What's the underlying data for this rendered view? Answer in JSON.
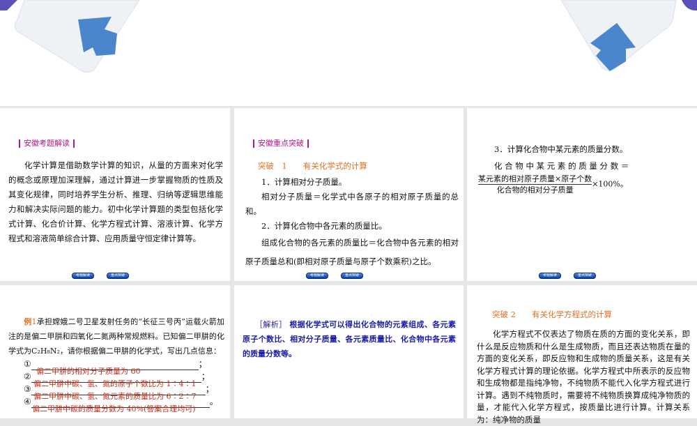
{
  "nav": {
    "prev": "考题解读",
    "next": "重点突破"
  },
  "p1": {
    "heading": "安徽考题解读",
    "text": "化学计算是借助数学计算的知识，从量的方面来对化学的概念或原理加深理解，通过计算进一步掌握物质的性质及其变化规律，同时培养学生分析、推理、归纳等逻辑思维能力和解决实际问题的能力。初中化学计算题的类型包括化学式计算、化合价计算、化学方程式计算、溶液计算、化学方程式和溶液简单综合计算、应用质量守恒定律计算等。"
  },
  "p2": {
    "heading": "安徽重点突破",
    "sub": "突破　1　　有关化学式的计算",
    "l1": "1．计算相对分子质量。",
    "l2": "相对分子质量＝化学式中各原子的相对原子质量的总和。",
    "l3": "2．计算化合物中各元素的质量比。",
    "l4": "组成化合物的各元素的质量比＝化合物中各元素的相对原子质量总和(即相对原子质量与原子个数乘积)之比。"
  },
  "p3": {
    "l1": "3．计算化合物中某元素的质量分数。",
    "l2": "化 合 物 中 某 元 素 的 质 量 分 数 ＝",
    "num": "某元素的相对原子质量×原子个数",
    "den": "化合物的相对分子质量",
    "tail": "×100%。"
  },
  "p4": {
    "label": "例",
    "num": "1",
    "q1": "承担嫦娥二号卫星发射任务的“长征三号丙”运载火箭加注的是偏二甲肼和四氧化二氮两种常规燃料。已知偏二甲肼的化学式为",
    "formula": "C₂H₈N₂",
    "q2": "，请你根据偏二甲肼的化学式，写出几点信息：",
    "marks": [
      "①",
      "②",
      "③",
      "④"
    ],
    "ends": [
      "；",
      "；",
      "；",
      "。"
    ],
    "answers": [
      "偏二甲肼的相对分子质量为 60",
      "偏二甲肼中碳、氢、氮的原子个数比为 1∶4∶1",
      "偏二甲肼中碳、氢、氮元素的质量比为 6∶2∶7",
      "偏二甲肼中碳的质量分数为 40%(答案合理均可)"
    ]
  },
  "p5": {
    "label": "［解析］",
    "text": "根据化学式可以得出化合物的元素组成、各元素原子个数比、相对分子质量、各元素质量比、化合物中各元素的质量分数等。"
  },
  "p6": {
    "sub": "突破 2　　有关化学方程式的计算",
    "text": "化学方程式不仅表达了物质在质的方面的变化关系，即什么是反应物质和什么是生成物质，而且还表达物质在量的方面的变化关系，即反应物和生成物的质量关系，这是有关化学方程式计算的理论依据。化学方程式中所表示的反应物和生成物都是指纯净物，不纯物质不能代入化学方程式进行计算。遇到不纯物质时，需要将不纯物质换算成纯净物质的量，才能代入化学方程式，按质量比进行计算。计算关系为：纯净物的质量"
  }
}
